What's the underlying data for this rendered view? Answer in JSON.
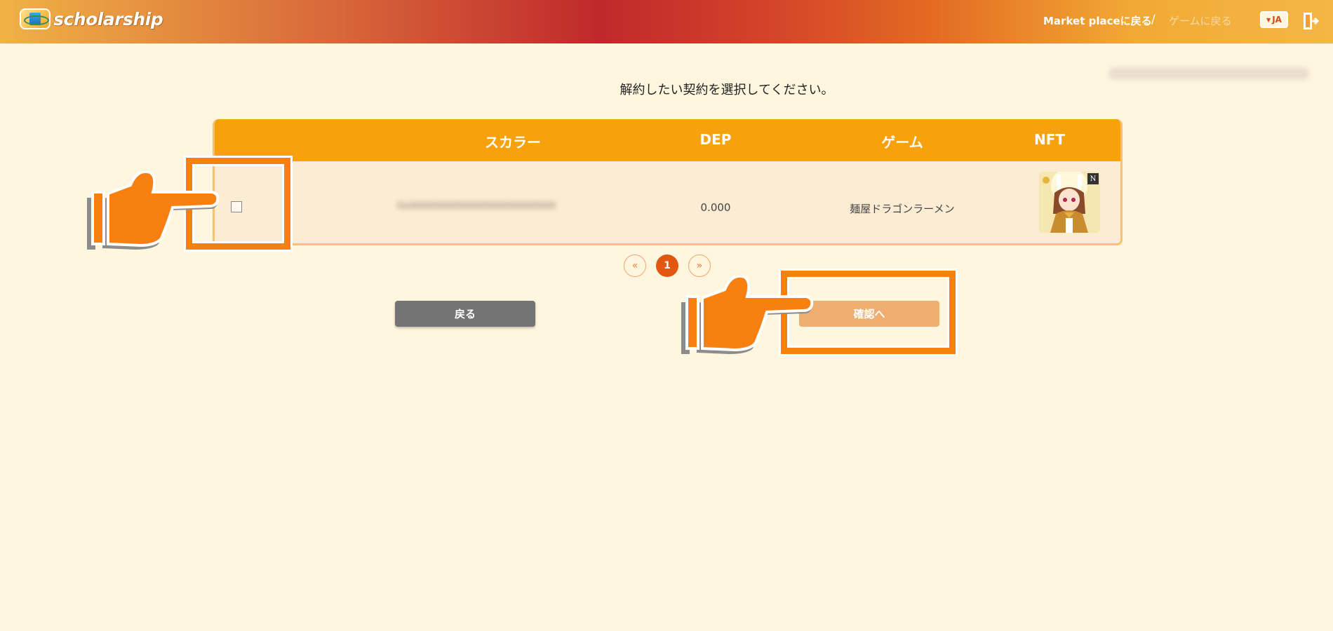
{
  "header": {
    "logo_text": "scholarship",
    "nav_market": "Market placeに戻る",
    "nav_separator": "/",
    "nav_game": "ゲームに戻る",
    "lang": "JA",
    "lang_caret": "▼",
    "user_address_blurred": "0x0000000000000000000000000000000000"
  },
  "main": {
    "instruction": "解約したい契約を選択してください。",
    "table": {
      "columns": [
        "スカラー",
        "DEP",
        "ゲーム",
        "NFT"
      ],
      "rows": [
        {
          "scholar": "0x0000000000000000000000000000000000",
          "dep": "0.000",
          "game": "麺屋ドラゴンラーメン",
          "nft_badge": "N"
        }
      ]
    },
    "pagination": {
      "prev": "«",
      "current": "1",
      "next": "»"
    },
    "buttons": {
      "back": "戻る",
      "confirm": "確認へ"
    }
  },
  "colors": {
    "accent": "#f7a10c",
    "highlight": "#f78011",
    "background": "#fff6df"
  }
}
